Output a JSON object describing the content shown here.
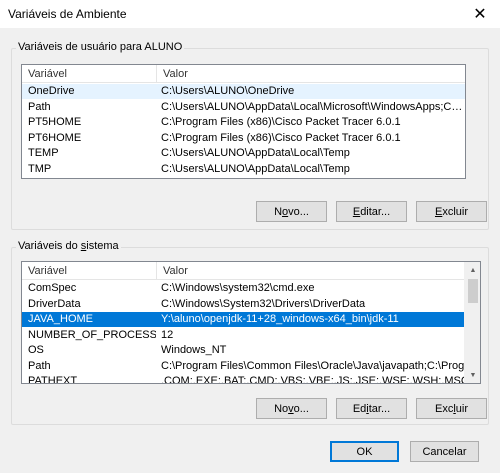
{
  "window": {
    "title": "Variáveis de Ambiente",
    "close_glyph": "✕"
  },
  "user_vars": {
    "group_label": "Variáveis de usuário para ALUNO",
    "col_variable": "Variável",
    "col_value": "Valor",
    "rows": [
      {
        "name": "OneDrive",
        "value": "C:\\Users\\ALUNO\\OneDrive"
      },
      {
        "name": "Path",
        "value": "C:\\Users\\ALUNO\\AppData\\Local\\Microsoft\\WindowsApps;C:\\Users..."
      },
      {
        "name": "PT5HOME",
        "value": "C:\\Program Files (x86)\\Cisco Packet Tracer 6.0.1"
      },
      {
        "name": "PT6HOME",
        "value": "C:\\Program Files (x86)\\Cisco Packet Tracer 6.0.1"
      },
      {
        "name": "TEMP",
        "value": "C:\\Users\\ALUNO\\AppData\\Local\\Temp"
      },
      {
        "name": "TMP",
        "value": "C:\\Users\\ALUNO\\AppData\\Local\\Temp"
      }
    ],
    "btn_new": {
      "pre": "N",
      "acc": "o",
      "post": "vo..."
    },
    "btn_edit": {
      "pre": "",
      "acc": "E",
      "post": "ditar..."
    },
    "btn_delete": {
      "pre": "",
      "acc": "E",
      "post": "xcluir"
    }
  },
  "system_vars": {
    "group_label_pre": "Variáveis do ",
    "group_label_acc": "s",
    "group_label_post": "istema",
    "col_variable": "Variável",
    "col_value": "Valor",
    "rows": [
      {
        "name": "ComSpec",
        "value": "C:\\Windows\\system32\\cmd.exe"
      },
      {
        "name": "DriverData",
        "value": "C:\\Windows\\System32\\Drivers\\DriverData"
      },
      {
        "name": "JAVA_HOME",
        "value": "Y:\\aluno\\openjdk-11+28_windows-x64_bin\\jdk-11"
      },
      {
        "name": "NUMBER_OF_PROCESSORS",
        "value": "12"
      },
      {
        "name": "OS",
        "value": "Windows_NT"
      },
      {
        "name": "Path",
        "value": "C:\\Program Files\\Common Files\\Oracle\\Java\\javapath;C:\\Program ..."
      },
      {
        "name": "PATHEXT",
        "value": ".COM;.EXE;.BAT;.CMD;.VBS;.VBE;.JS;.JSE;.WSF;.WSH;.MSC"
      }
    ],
    "selected_index": 2,
    "btn_new": {
      "pre": "No",
      "acc": "v",
      "post": "o..."
    },
    "btn_edit": {
      "pre": "Ed",
      "acc": "i",
      "post": "tar..."
    },
    "btn_delete": {
      "pre": "Exc",
      "acc": "l",
      "post": "uir"
    },
    "scroll_up": "▲",
    "scroll_down": "▼"
  },
  "footer": {
    "ok_label": "OK",
    "cancel_label": "Cancelar"
  },
  "colors": {
    "selection": "#0078d7",
    "hover": "#e5f3ff"
  }
}
